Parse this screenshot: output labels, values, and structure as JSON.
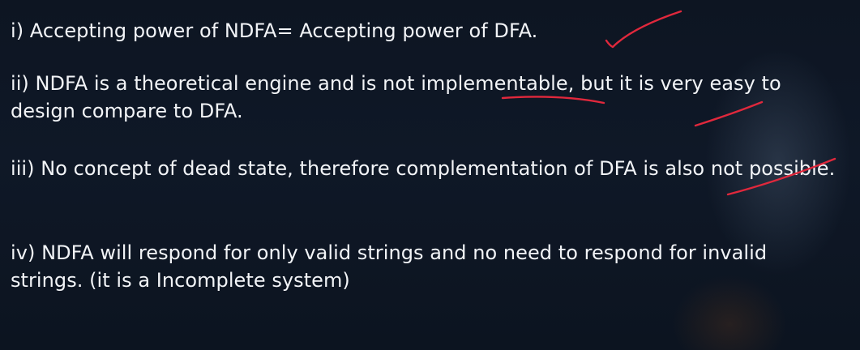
{
  "slide": {
    "points": [
      {
        "text": "i) Accepting power of NDFA= Accepting power of DFA."
      },
      {
        "text": "ii) NDFA is a theoretical engine and is not implementable, but it is very easy to design compare to DFA."
      },
      {
        "text": "iii) No concept of dead state, therefore complementation of DFA is also not possible."
      },
      {
        "text": "iv) NDFA will respond for only valid strings and no need to respond for invalid strings. (it is a Incomplete system)"
      }
    ]
  },
  "annotation_marks": {
    "color": "#e0283c",
    "marks": [
      "tick-mark",
      "underline-implementable",
      "tick-mark",
      "underline-not"
    ]
  }
}
